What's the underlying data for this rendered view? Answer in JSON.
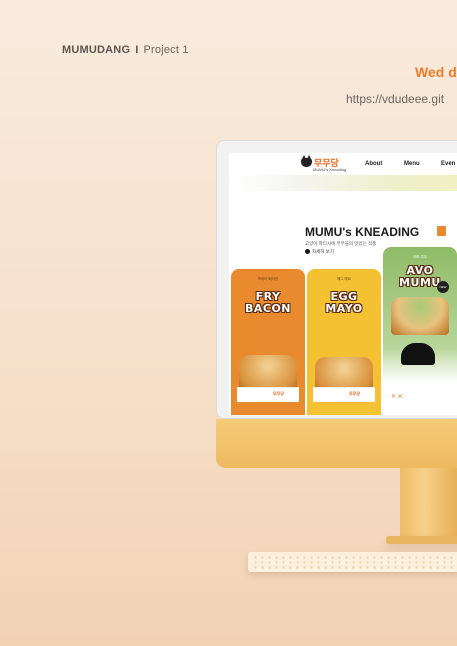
{
  "header": {
    "brand": "MUMUDANG",
    "separator": "I",
    "project": "Project 1",
    "date_fragment": "Wed d",
    "url_fragment": "https://vdudeee.git"
  },
  "website": {
    "logo_text": "무무당",
    "logo_sub": "MUMU's Kneading",
    "nav": [
      "About",
      "Menu",
      "Even"
    ],
    "headline": "MUMU's KNEADING",
    "sub_copy": "고양이 파티시에 무무들의 맛있는 작품",
    "detail_link": "자세히 보기",
    "cards": [
      {
        "tag": "프라이 베이컨",
        "name_line1": "FRY",
        "name_line2": "BACON",
        "color": "#ea8a2e"
      },
      {
        "tag": "에그 마요",
        "name_line1": "EGG",
        "name_line2": "MAYO",
        "color": "#f4c133"
      },
      {
        "tag": "아보 무무",
        "name_line1": "AVO",
        "name_line2": "MUMU",
        "color": "#8fbb67"
      }
    ],
    "box_logo": "무무당",
    "badge": "NEW"
  },
  "colors": {
    "accent": "#f07a25",
    "background": "#f8ebde",
    "monitor_chin": "#f5cc7a"
  }
}
